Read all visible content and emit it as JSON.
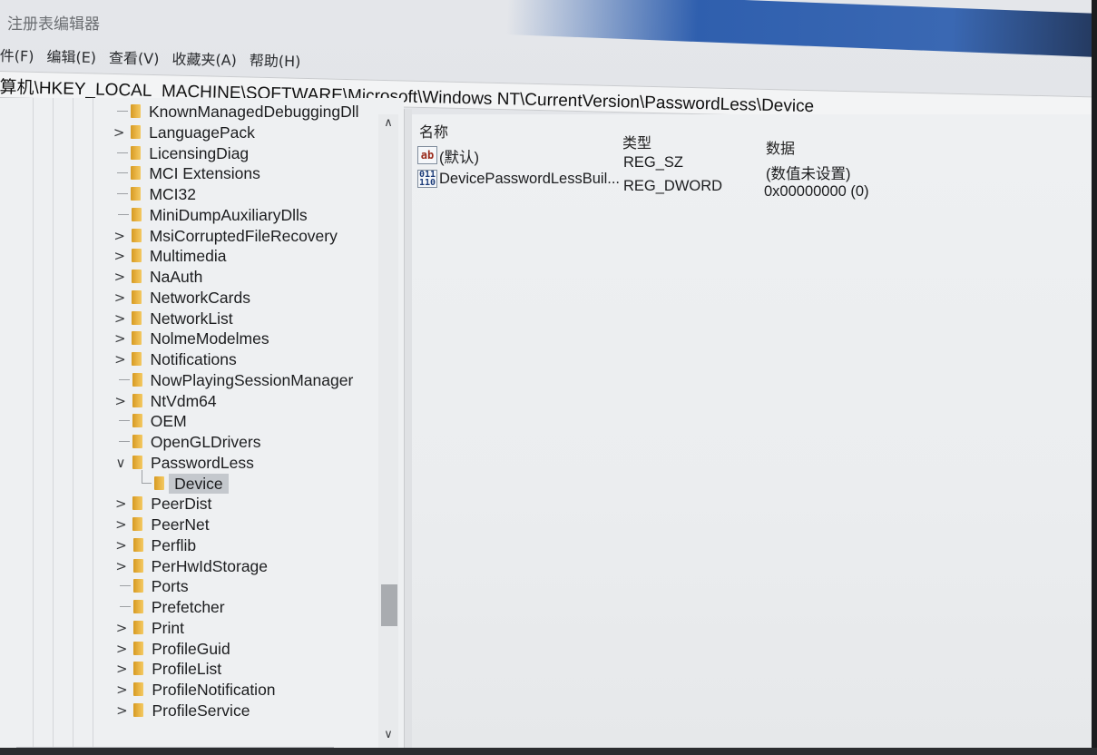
{
  "window": {
    "title": "注册表编辑器"
  },
  "menu": {
    "items": [
      "件(F)",
      "编辑(E)",
      "查看(V)",
      "收藏夹(A)",
      "帮助(H)"
    ]
  },
  "address": {
    "path": "算机\\HKEY_LOCAL_MACHINE\\SOFTWARE\\Microsoft\\Windows NT\\CurrentVersion\\PasswordLess\\Device"
  },
  "tree": {
    "items": [
      {
        "label": "KnownManagedDebuggingDll",
        "expander": ""
      },
      {
        "label": "LanguagePack",
        "expander": ">"
      },
      {
        "label": "LicensingDiag",
        "expander": ""
      },
      {
        "label": "MCI Extensions",
        "expander": ""
      },
      {
        "label": "MCI32",
        "expander": ""
      },
      {
        "label": "MiniDumpAuxiliaryDlls",
        "expander": ""
      },
      {
        "label": "MsiCorruptedFileRecovery",
        "expander": ">"
      },
      {
        "label": "Multimedia",
        "expander": ">"
      },
      {
        "label": "NaAuth",
        "expander": ">"
      },
      {
        "label": "NetworkCards",
        "expander": ">"
      },
      {
        "label": "NetworkList",
        "expander": ">"
      },
      {
        "label": "NolmeModelmes",
        "expander": ">"
      },
      {
        "label": "Notifications",
        "expander": ">"
      },
      {
        "label": "NowPlayingSessionManager",
        "expander": ""
      },
      {
        "label": "NtVdm64",
        "expander": ">"
      },
      {
        "label": "OEM",
        "expander": ""
      },
      {
        "label": "OpenGLDrivers",
        "expander": ""
      },
      {
        "label": "PasswordLess",
        "expander": "∨"
      },
      {
        "label": "Device",
        "expander": "",
        "selected": true
      },
      {
        "label": "PeerDist",
        "expander": ">"
      },
      {
        "label": "PeerNet",
        "expander": ">"
      },
      {
        "label": "Perflib",
        "expander": ">"
      },
      {
        "label": "PerHwIdStorage",
        "expander": ">"
      },
      {
        "label": "Ports",
        "expander": ""
      },
      {
        "label": "Prefetcher",
        "expander": ""
      },
      {
        "label": "Print",
        "expander": ">"
      },
      {
        "label": "ProfileGuid",
        "expander": ">"
      },
      {
        "label": "ProfileList",
        "expander": ">"
      },
      {
        "label": "ProfileNotification",
        "expander": ">"
      },
      {
        "label": "ProfileService",
        "expander": ">"
      }
    ]
  },
  "values": {
    "columns": {
      "name": "名称",
      "type": "类型",
      "data": "数据"
    },
    "rows": [
      {
        "icon": "string-value-icon",
        "icon_text": "ab",
        "name": "(默认)",
        "type": "REG_SZ",
        "data": "(数值未设置)"
      },
      {
        "icon": "binary-value-icon",
        "icon_text": "011\n110",
        "name": "DevicePasswordLessBuil...",
        "type": "REG_DWORD",
        "data": "0x00000000 (0)"
      }
    ]
  },
  "colors": {
    "folder": "#eab546",
    "selection": "#c4c8cd",
    "pane_background": "#eef0f2"
  }
}
